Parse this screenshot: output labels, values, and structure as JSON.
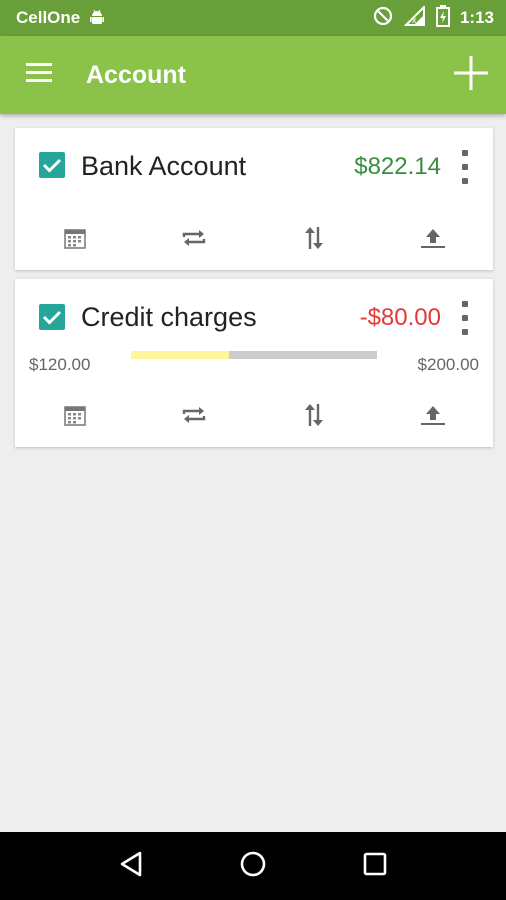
{
  "status_bar": {
    "carrier": "CellOne",
    "time": "1:13",
    "icons": [
      "android-icon",
      "no-sim-icon",
      "signal-icon",
      "battery-icon"
    ]
  },
  "app_bar": {
    "title": "Account",
    "menu_icon": "menu-icon",
    "add_icon": "add-icon"
  },
  "accounts": [
    {
      "name": "Bank Account",
      "checked": true,
      "balance": "$822.14",
      "balance_color": "#388e3c"
    },
    {
      "name": "Credit charges",
      "checked": true,
      "balance": "-$80.00",
      "balance_color": "#e53935",
      "range": {
        "min_label": "$120.00",
        "max_label": "$200.00",
        "progress": 0.4
      }
    }
  ],
  "card_actions": [
    "calendar-icon",
    "repeat-icon",
    "transfer-icon",
    "upload-icon"
  ],
  "nav_bar": [
    "back-icon",
    "home-icon",
    "recents-icon"
  ],
  "colors": {
    "status_bar": "#689f38",
    "app_bar": "#8bc34a",
    "checkbox": "#26a69a",
    "positive": "#388e3c",
    "negative": "#e53935",
    "progress_fill": "#fff59d",
    "progress_track": "#cccccc"
  }
}
